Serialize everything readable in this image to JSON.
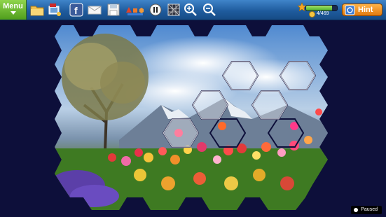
{
  "toolbar": {
    "menu_label": "Menu",
    "hint_label": "Hint",
    "progress_text": "4/469",
    "progress_fraction": 0.85,
    "tools": [
      "folder-icon",
      "photo-flag-icon",
      "facebook-icon",
      "email-icon",
      "save-icon",
      "shapes-icon",
      "pause-rotate-icon",
      "grid-icon",
      "zoom-in-icon",
      "zoom-out-icon"
    ]
  },
  "status": {
    "label": "Paused"
  },
  "colors": {
    "background": "#0d0f3a",
    "toolbar": "#1f5c9e",
    "menu": "#6cbf2e",
    "hint": "#f08a1e"
  }
}
